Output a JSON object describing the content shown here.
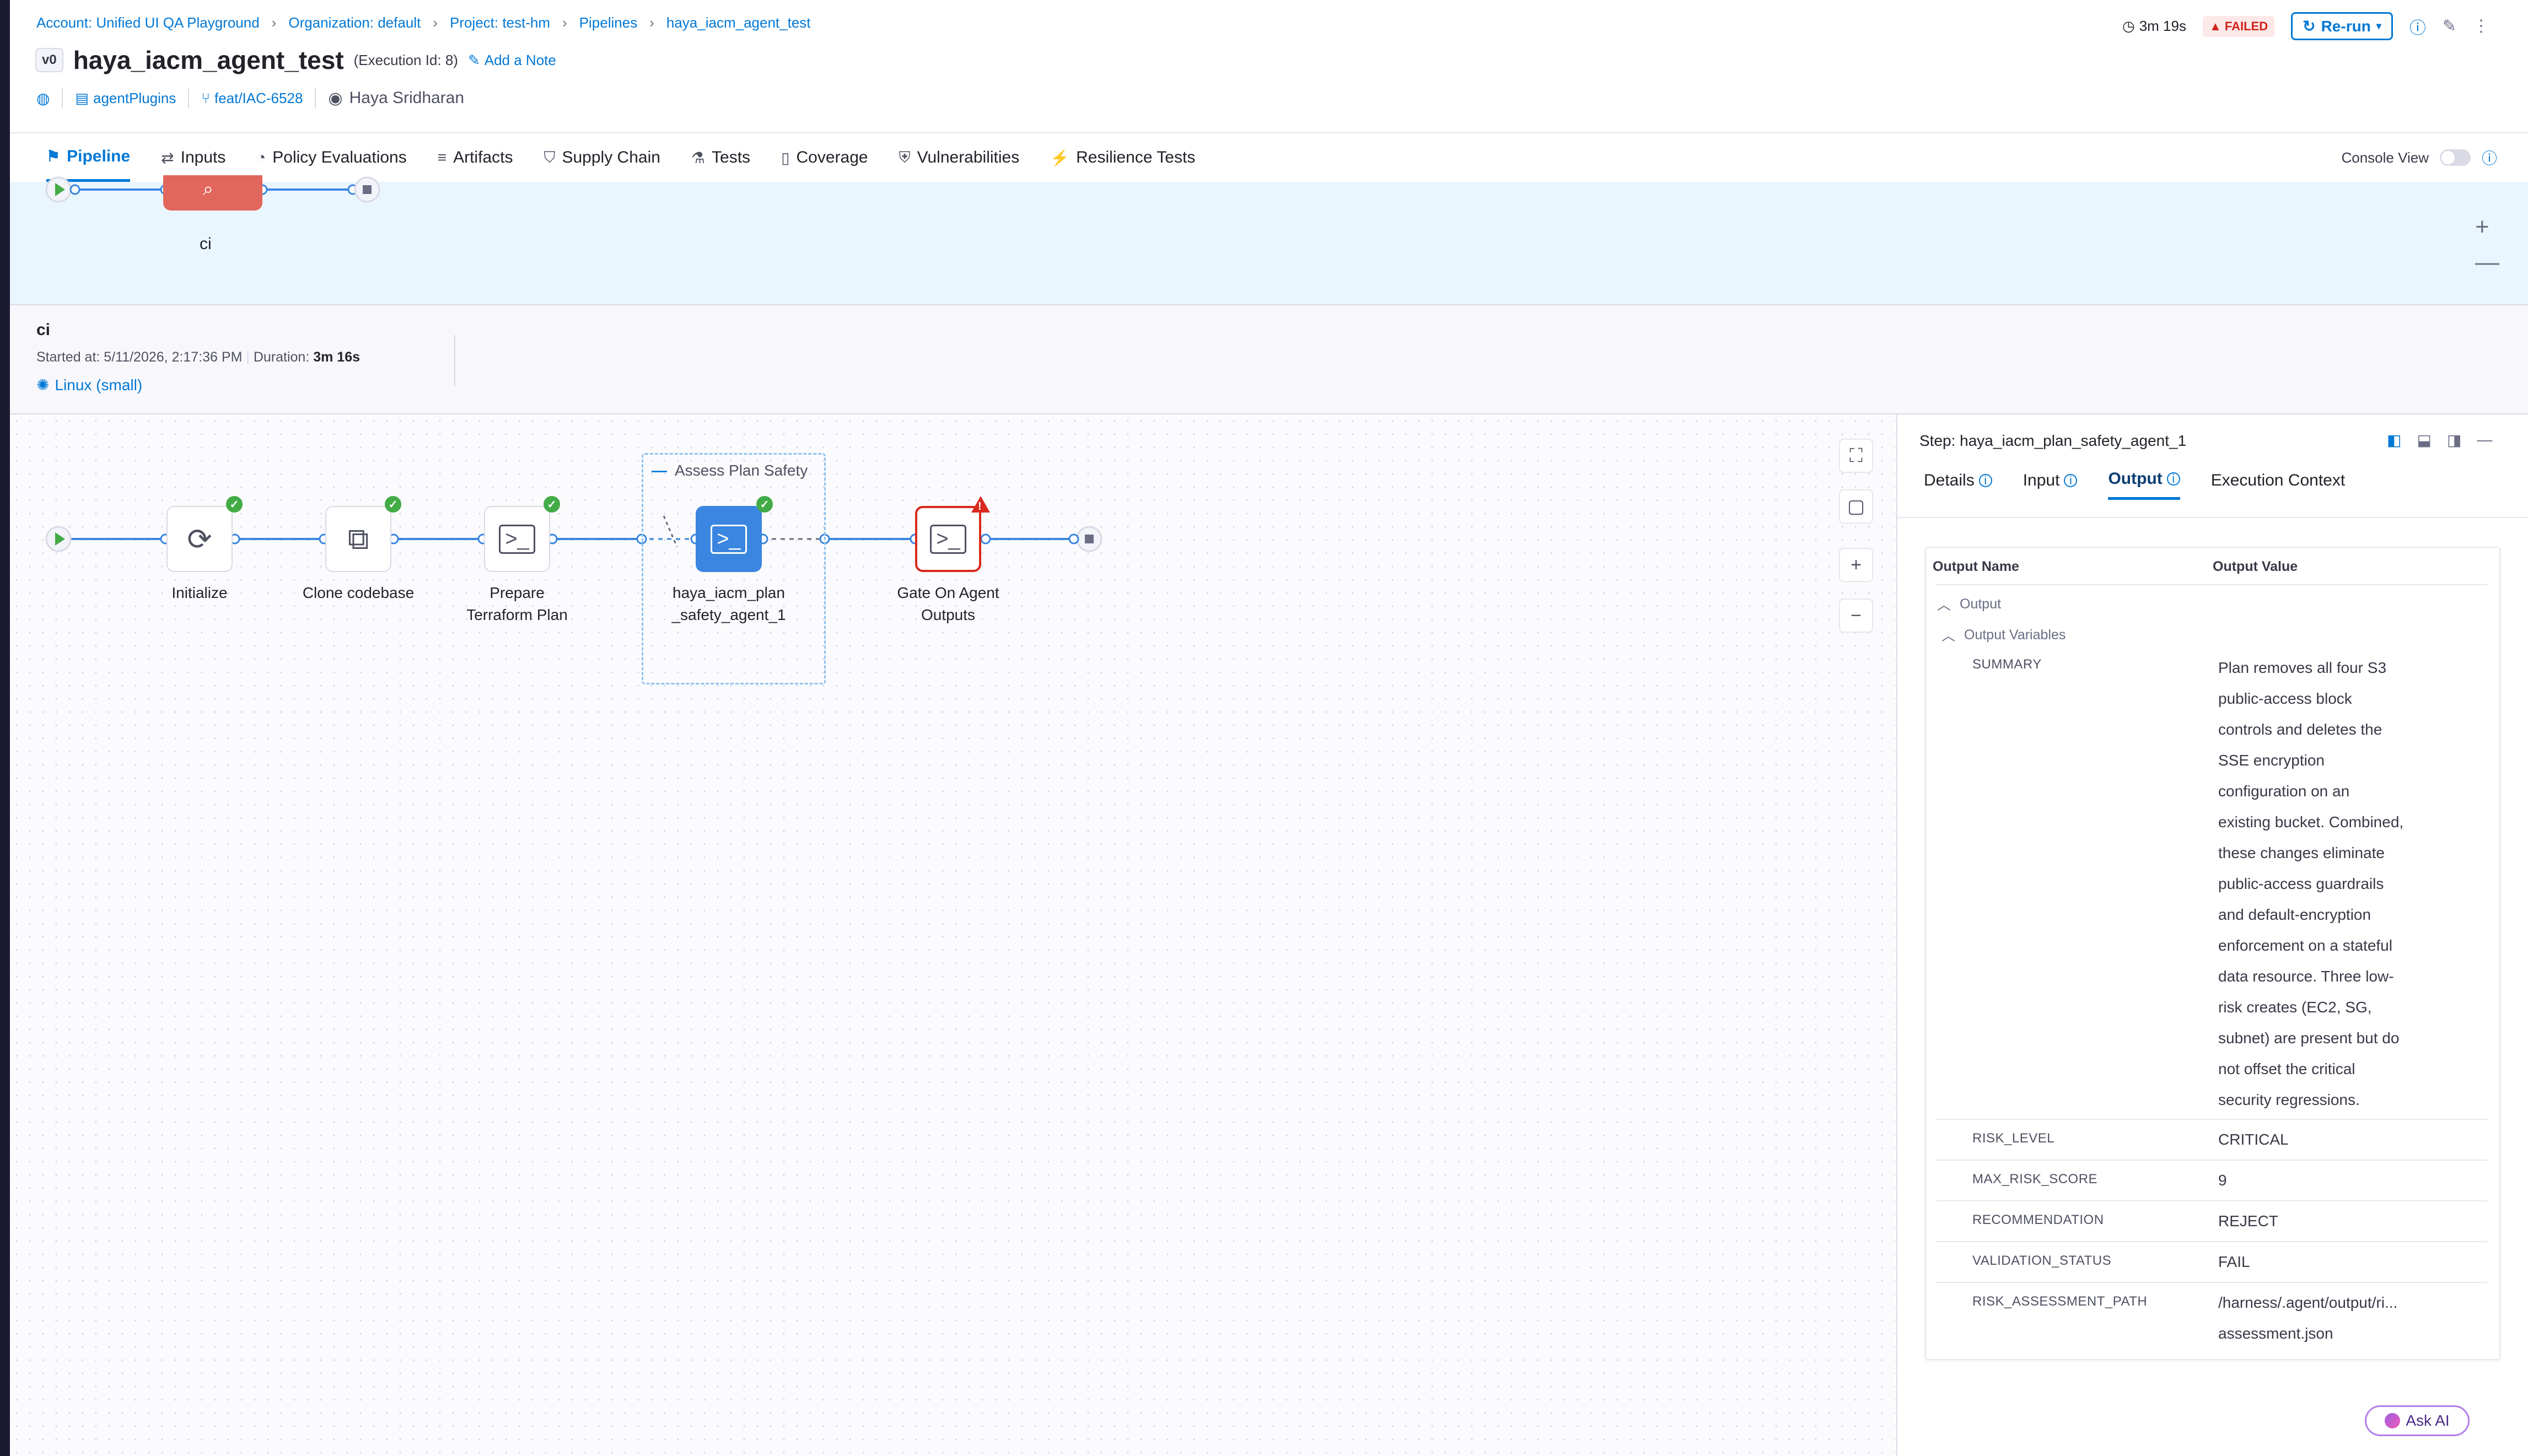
{
  "breadcrumbs": [
    "Account: Unified UI QA Playground",
    "Organization: default",
    "Project: test-hm",
    "Pipelines",
    "haya_iacm_agent_test"
  ],
  "header": {
    "version": "v0",
    "title": "haya_iacm_agent_test",
    "execution_id": "(Execution Id: 8)",
    "add_note": "Add a Note",
    "repo": "agentPlugins",
    "branch": "feat/IAC-6528",
    "user": "Haya Sridharan",
    "duration": "3m 19s",
    "status": "FAILED",
    "rerun": "Re-run"
  },
  "tabs": [
    {
      "label": "Pipeline",
      "icon": "pipeline-icon",
      "active": true
    },
    {
      "label": "Inputs",
      "icon": "inputs-icon"
    },
    {
      "label": "Policy Evaluations",
      "icon": "policy-icon"
    },
    {
      "label": "Artifacts",
      "icon": "artifacts-icon"
    },
    {
      "label": "Supply Chain",
      "icon": "supply-chain-icon"
    },
    {
      "label": "Tests",
      "icon": "tests-icon"
    },
    {
      "label": "Coverage",
      "icon": "coverage-icon"
    },
    {
      "label": "Vulnerabilities",
      "icon": "vulnerabilities-icon"
    },
    {
      "label": "Resilience Tests",
      "icon": "resilience-icon"
    }
  ],
  "console_view": "Console View",
  "stage": {
    "label": "ci",
    "name": "ci",
    "started_label": "Started at: 5/11/2026, 2:17:36 PM",
    "duration_label": "Duration:",
    "duration_value": "3m 16s",
    "infra": "Linux (small)"
  },
  "graph": {
    "group_title": "Assess Plan Safety",
    "steps": [
      {
        "label_1": "Initialize",
        "label_2": ""
      },
      {
        "label_1": "Clone codebase",
        "label_2": ""
      },
      {
        "label_1": "Prepare",
        "label_2": "Terraform Plan"
      },
      {
        "label_1": "haya_iacm_plan",
        "label_2": "_safety_agent_1"
      },
      {
        "label_1": "Gate On Agent",
        "label_2": "Outputs"
      }
    ]
  },
  "panel": {
    "step_title": "Step: haya_iacm_plan_safety_agent_1",
    "tabs": [
      "Details",
      "Input",
      "Output",
      "Execution Context"
    ],
    "col_name": "Output Name",
    "col_value": "Output Value",
    "section_output": "Output",
    "section_vars": "Output Variables",
    "summary_key": "SUMMARY",
    "summary_lines": [
      "Plan removes all four S3",
      "public-access block",
      "controls and deletes the",
      "SSE encryption",
      "configuration on an",
      "existing bucket. Combined,",
      "these changes eliminate",
      "public-access guardrails",
      "and default-encryption",
      "enforcement on a stateful",
      "data resource. Three low-",
      "risk creates (EC2, SG,",
      "subnet) are present but do",
      "not offset the critical",
      "security regressions."
    ],
    "rows": [
      {
        "key": "RISK_LEVEL",
        "value": "CRITICAL"
      },
      {
        "key": "MAX_RISK_SCORE",
        "value": "9"
      },
      {
        "key": "RECOMMENDATION",
        "value": "REJECT"
      },
      {
        "key": "VALIDATION_STATUS",
        "value": "FAIL"
      }
    ],
    "path_key": "RISK_ASSESSMENT_PATH",
    "path_line1": "/harness/.agent/output/ri...",
    "path_line2": "assessment.json"
  },
  "ask_ai": "Ask AI"
}
